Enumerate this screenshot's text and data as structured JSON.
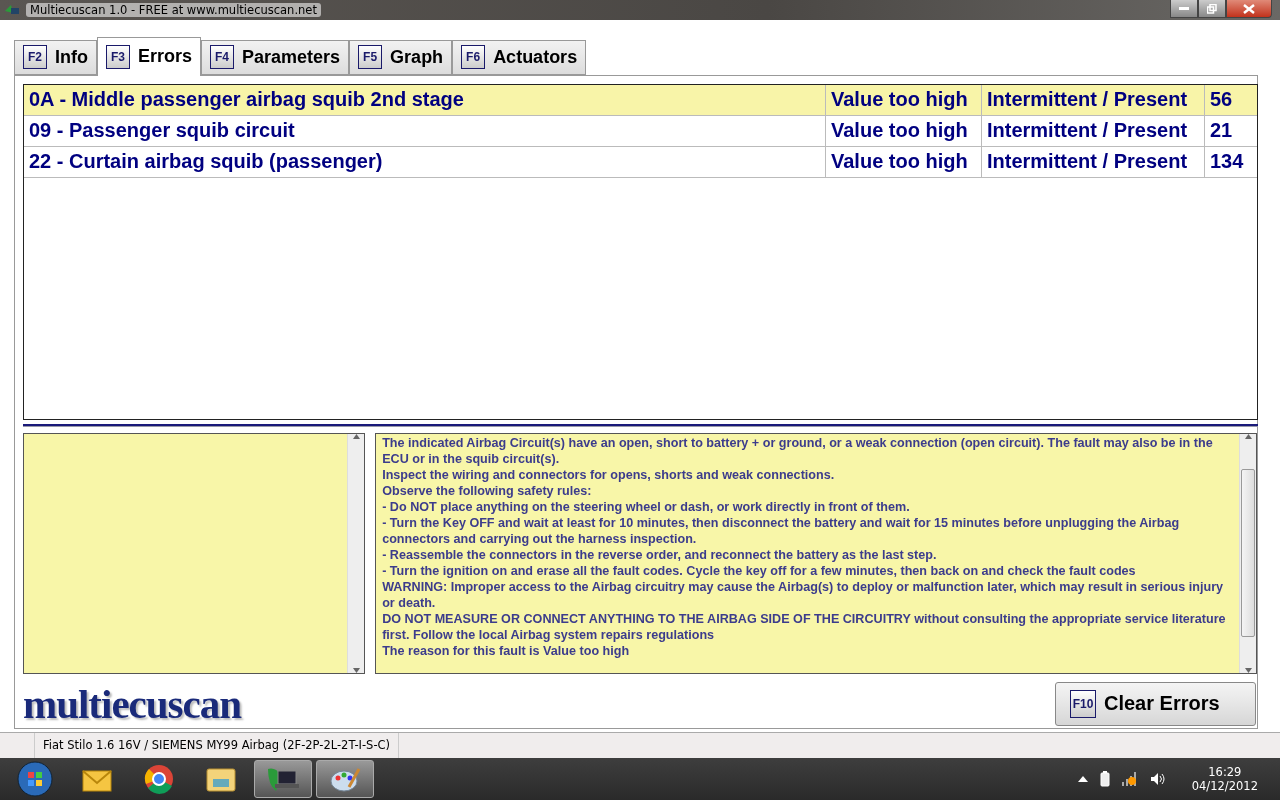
{
  "window": {
    "title": "Multiecuscan 1.0 - FREE at www.multiecuscan.net"
  },
  "tabs": [
    {
      "key": "F2",
      "label": "Info",
      "selected": false
    },
    {
      "key": "F3",
      "label": "Errors",
      "selected": true
    },
    {
      "key": "F4",
      "label": "Parameters",
      "selected": false
    },
    {
      "key": "F5",
      "label": "Graph",
      "selected": false
    },
    {
      "key": "F6",
      "label": "Actuators",
      "selected": false
    }
  ],
  "errors": [
    {
      "description": "0A - Middle passenger airbag squib 2nd stage",
      "condition": "Value too high",
      "status": "Intermittent / Present",
      "count": "56",
      "selected": true
    },
    {
      "description": "09 - Passenger squib circuit",
      "condition": "Value too high",
      "status": "Intermittent / Present",
      "count": "21",
      "selected": false
    },
    {
      "description": "22 - Curtain airbag squib (passenger)",
      "condition": "Value too high",
      "status": "Intermittent / Present",
      "count": "134",
      "selected": false
    }
  ],
  "details": [
    "The indicated Airbag Circuit(s) have an open, short to battery + or ground, or a weak connection (open circuit). The fault may also be in the ECU or in the squib circuit(s).",
    "Inspect the wiring and connectors for opens, shorts and weak connections.",
    "Observe the following safety rules:",
    "- Do NOT place anything on the steering wheel or dash, or work directly in front of them.",
    "- Turn the Key OFF and wait at least for 10 minutes, then disconnect the battery and wait for 15 minutes before unplugging the Airbag connectors and carrying out the harness inspection.",
    "- Reassemble the connectors in the reverse order, and reconnect the battery as the last step.",
    "- Turn the ignition on and erase all the fault codes. Cycle the key off for a few minutes, then back on and check the fault codes",
    "WARNING: Improper access to the Airbag circuitry may cause the Airbag(s) to deploy or malfunction later, which may result in serious injury or death.",
    "DO NOT MEASURE OR CONNECT ANYTHING TO THE AIRBAG SIDE OF THE CIRCUITRY without consulting the appropriate service literature first. Follow the local Airbag system repairs regulations",
    "The reason for this fault is Value too high"
  ],
  "logo": "multiecuscan",
  "clear_button": {
    "key": "F10",
    "label": "Clear Errors"
  },
  "status_bar": "Fiat Stilo 1.6 16V / SIEMENS MY99 Airbag (2F-2P-2L-2T-I-S-C)",
  "taskbar": {
    "time": "16:29",
    "date": "04/12/2012"
  }
}
